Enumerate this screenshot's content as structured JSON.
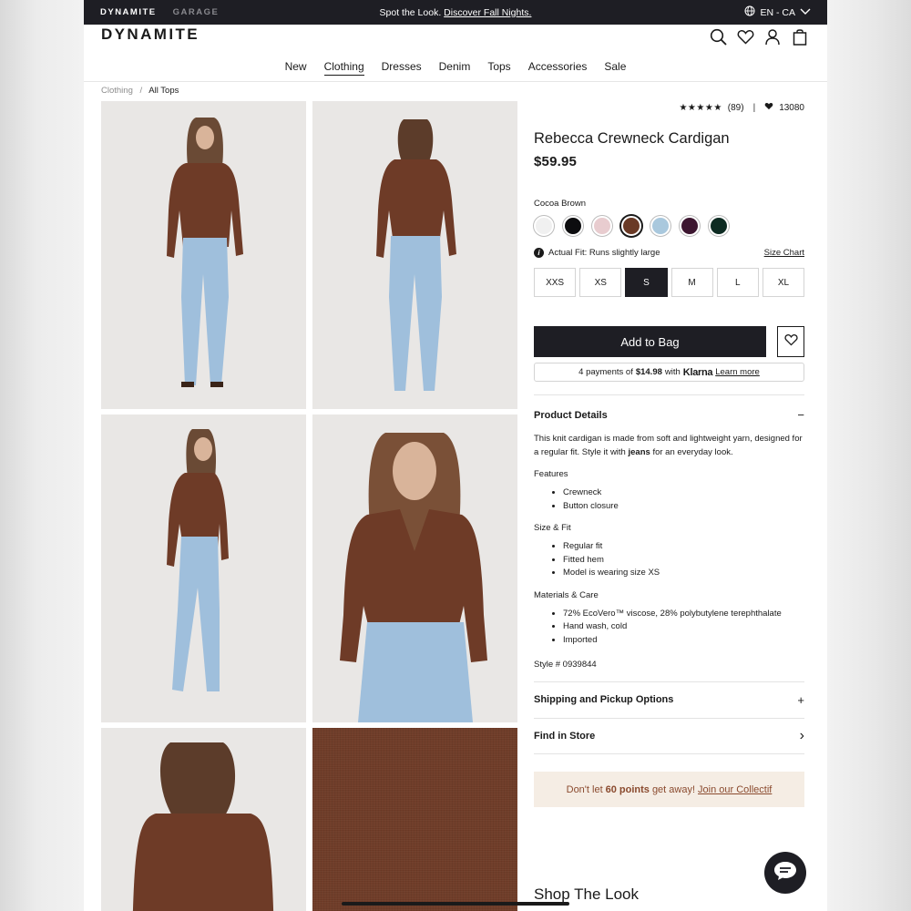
{
  "topbar": {
    "brand_primary": "DYNAMITE",
    "brand_secondary": "GARAGE",
    "promo_text": "Spot the Look.",
    "promo_link": "Discover Fall Nights.",
    "locale": "EN - CA"
  },
  "header": {
    "logo": "DYNAMITE",
    "icons": [
      "search-icon",
      "heart-icon",
      "account-icon",
      "bag-icon"
    ]
  },
  "nav": {
    "items": [
      "New",
      "Clothing",
      "Dresses",
      "Denim",
      "Tops",
      "Accessories",
      "Sale"
    ],
    "active": "Clothing"
  },
  "breadcrumb": {
    "parent": "Clothing",
    "separator": "/",
    "current": "All Tops"
  },
  "product": {
    "stars": "★★★★★",
    "review_count": "(89)",
    "favorites": "13080",
    "title": "Rebecca Crewneck Cardigan",
    "price": "$59.95",
    "color_name": "Cocoa Brown",
    "swatches": [
      {
        "color": "#f0f0f0",
        "selected": false
      },
      {
        "color": "#0d0d0f",
        "selected": false
      },
      {
        "color": "#e8cccf",
        "selected": false
      },
      {
        "color": "#6a3a26",
        "selected": true
      },
      {
        "color": "#a9c8dd",
        "selected": false
      },
      {
        "color": "#3d1630",
        "selected": false
      },
      {
        "color": "#0d2b22",
        "selected": false
      }
    ],
    "fit_note": "Actual Fit: Runs slightly large",
    "size_chart": "Size Chart",
    "sizes": [
      "XXS",
      "XS",
      "S",
      "M",
      "L",
      "XL"
    ],
    "selected_size": "S",
    "add_to_bag": "Add to Bag",
    "klarna": {
      "prefix": "4 payments of",
      "amount": "$14.98",
      "with": "with",
      "brand": "Klarna",
      "learn": "Learn more"
    }
  },
  "details": {
    "heading": "Product Details",
    "toggle": "−",
    "description_before": "This knit cardigan is made from soft and lightweight yarn, designed for a regular fit. Style it with",
    "description_bold": "jeans",
    "description_after": "for an everyday look.",
    "features_title": "Features",
    "features": [
      "Crewneck",
      "Button closure"
    ],
    "fit_title": "Size & Fit",
    "fit": [
      "Regular fit",
      "Fitted hem",
      "Model is wearing size XS"
    ],
    "materials_title": "Materials & Care",
    "materials": [
      "72%  EcoVero™ viscose, 28% polybutylene terephthalate",
      "Hand wash, cold",
      "Imported"
    ],
    "style_number": "Style # 0939844"
  },
  "accordions": {
    "shipping": "Shipping and Pickup Options",
    "shipping_toggle": "+",
    "store": "Find in Store",
    "store_toggle": "›"
  },
  "points": {
    "before": "Don't let",
    "bold": "60 points",
    "after": "get away!",
    "link": "Join our Collectif"
  },
  "shop_the_look": "Shop The Look",
  "colors": {
    "dark": "#1e1e24",
    "cardigan": "#6e3b27",
    "denim": "#9fbfdc",
    "points_bg": "#f5ede4",
    "points_text": "#8a4a2e"
  }
}
